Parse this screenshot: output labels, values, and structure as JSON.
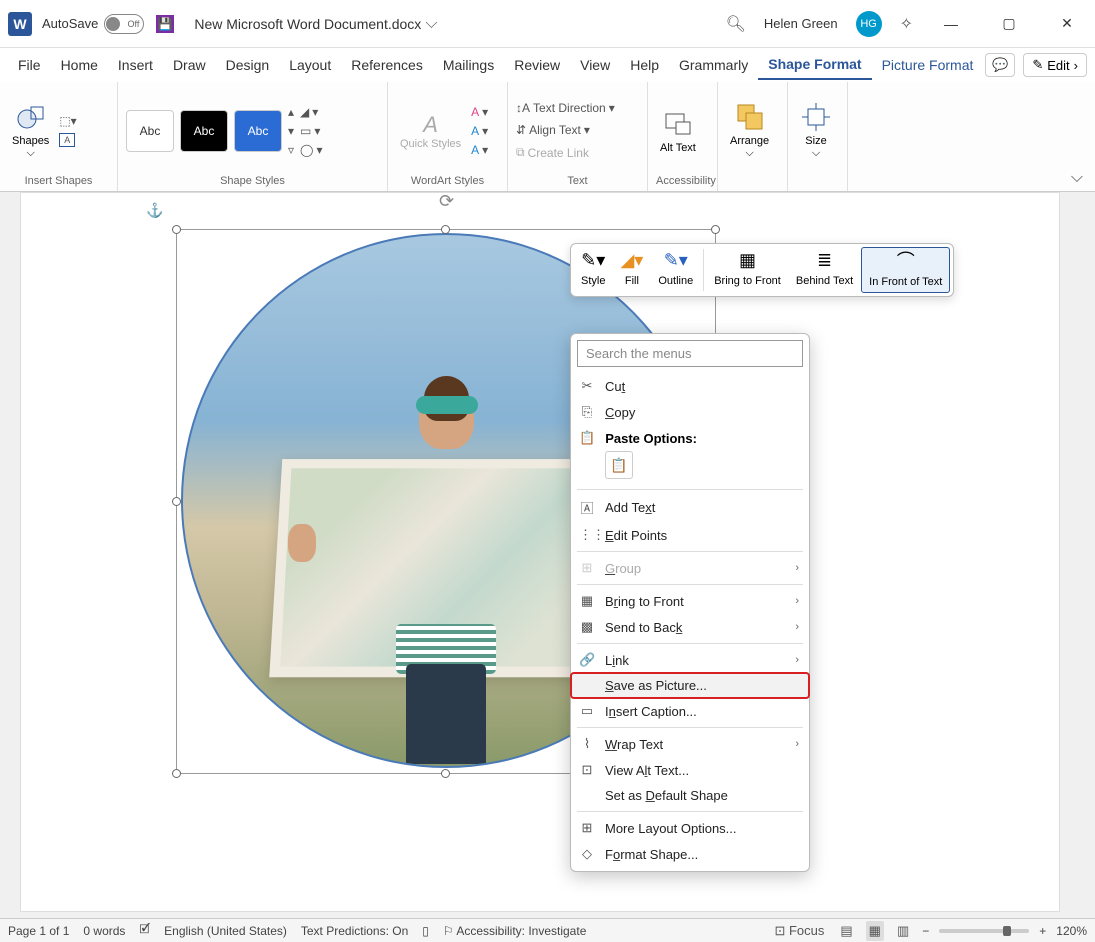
{
  "titlebar": {
    "autosave_label": "AutoSave",
    "autosave_state": "Off",
    "doc_title": "New Microsoft Word Document.docx",
    "user_name": "Helen Green",
    "user_initials": "HG"
  },
  "menu": {
    "tabs": [
      "File",
      "Home",
      "Insert",
      "Draw",
      "Design",
      "Layout",
      "References",
      "Mailings",
      "Review",
      "View",
      "Help",
      "Grammarly",
      "Shape Format",
      "Picture Format"
    ],
    "active_tab": "Shape Format",
    "edit_label": "Edit"
  },
  "ribbon": {
    "shapes_label": "Shapes",
    "insert_shapes": "Insert Shapes",
    "shape_styles": "Shape Styles",
    "style_abc": "Abc",
    "quick_styles": "Quick Styles",
    "wordart_styles": "WordArt Styles",
    "text_direction": "Text Direction",
    "align_text": "Align Text",
    "create_link": "Create Link",
    "text_group": "Text",
    "alt_text": "Alt Text",
    "accessibility": "Accessibility",
    "arrange": "Arrange",
    "size": "Size"
  },
  "mini_toolbar": {
    "style": "Style",
    "fill": "Fill",
    "outline": "Outline",
    "bring_front": "Bring to Front",
    "behind_text": "Behind Text",
    "in_front": "In Front of Text"
  },
  "context_menu": {
    "search_placeholder": "Search the menus",
    "cut": "Cut",
    "copy": "Copy",
    "paste_options": "Paste Options:",
    "add_text": "Add Text",
    "edit_points": "Edit Points",
    "group": "Group",
    "bring_to_front": "Bring to Front",
    "send_to_back": "Send to Back",
    "link": "Link",
    "save_as_picture": "Save as Picture...",
    "insert_caption": "Insert Caption...",
    "wrap_text": "Wrap Text",
    "view_alt_text": "View Alt Text...",
    "set_default": "Set as Default Shape",
    "more_layout": "More Layout Options...",
    "format_shape": "Format Shape..."
  },
  "statusbar": {
    "page": "Page 1 of 1",
    "words": "0 words",
    "language": "English (United States)",
    "predictions": "Text Predictions: On",
    "accessibility": "Accessibility: Investigate",
    "focus": "Focus",
    "zoom": "120%"
  }
}
